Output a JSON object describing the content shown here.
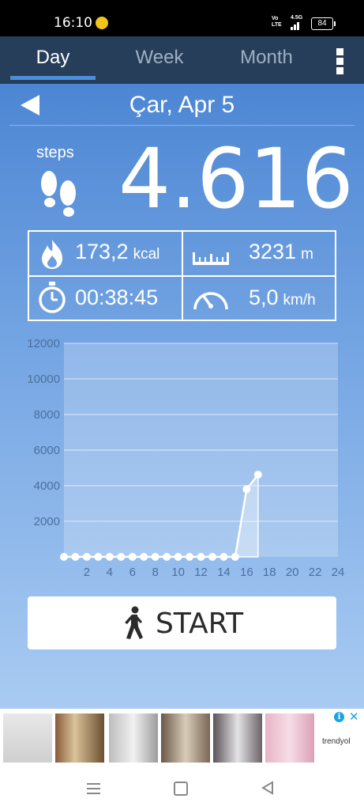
{
  "status_bar": {
    "time": "16:10",
    "volte_top": "Vo",
    "volte_bottom": "LTE",
    "network": "4.5G",
    "battery": "84"
  },
  "tabs": [
    {
      "label": "Day",
      "active": true
    },
    {
      "label": "Week",
      "active": false
    },
    {
      "label": "Month",
      "active": false
    }
  ],
  "date": "Çar, Apr 5",
  "steps": {
    "label": "steps",
    "value": "4.616"
  },
  "stats": {
    "calories": {
      "value": "173,2",
      "unit": "kcal"
    },
    "distance": {
      "value": "3231",
      "unit": "m"
    },
    "duration": {
      "value": "00:38:45"
    },
    "speed": {
      "value": "5,0",
      "unit": "km/h"
    }
  },
  "chart_data": {
    "type": "area",
    "x": [
      0,
      1,
      2,
      3,
      4,
      5,
      6,
      7,
      8,
      9,
      10,
      11,
      12,
      13,
      14,
      15,
      16,
      17
    ],
    "values": [
      0,
      0,
      0,
      0,
      0,
      0,
      0,
      0,
      0,
      0,
      0,
      0,
      0,
      0,
      0,
      0,
      3800,
      4616
    ],
    "y_ticks": [
      "12000",
      "10000",
      "8000",
      "6000",
      "4000",
      "2000"
    ],
    "x_ticks": [
      "2",
      "4",
      "6",
      "8",
      "10",
      "12",
      "14",
      "16",
      "18",
      "20",
      "22",
      "24"
    ],
    "ylim": [
      0,
      12000
    ],
    "xlim": [
      0,
      24
    ],
    "grid": true,
    "colors": {
      "line": "#ffffff",
      "fill": "rgba(255,255,255,0.35)",
      "axis_text": "#4a6f9e"
    }
  },
  "start_button": {
    "label": "START"
  },
  "ad": {
    "brand": "trendyol",
    "info_icon": "i",
    "close_icon": "✕",
    "thumbnails": [
      "lace-curtain",
      "window-curtain",
      "sheer-curtain",
      "patterned-curtain",
      "grey-curtain",
      "pink-curtain"
    ]
  },
  "colors": {
    "tab_bar": "#263e5a",
    "tab_indicator": "#4a90d9",
    "background_top": "#4c86d3",
    "background_bottom": "#a9cbf2"
  }
}
